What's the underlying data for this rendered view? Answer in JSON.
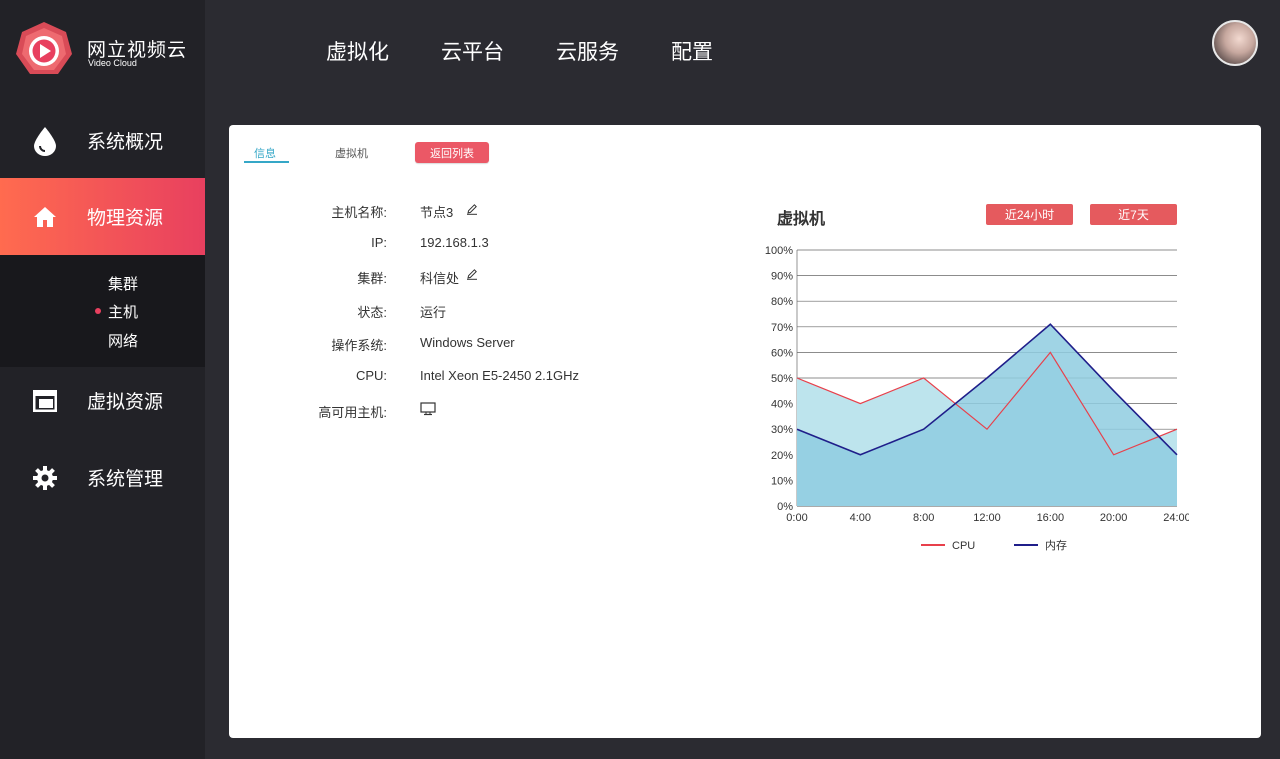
{
  "brand": {
    "title": "网立视频云",
    "subtitle": "Video Cloud"
  },
  "top_nav": [
    "虚拟化",
    "云平台",
    "云服务",
    "配置"
  ],
  "sidebar": {
    "items": [
      {
        "label": "系统概况",
        "icon": "drop-icon"
      },
      {
        "label": "物理资源",
        "icon": "home-icon",
        "active": true
      },
      {
        "label": "虚拟资源",
        "icon": "layout-icon"
      },
      {
        "label": "系统管理",
        "icon": "gear-icon"
      }
    ],
    "submenu": [
      {
        "label": "集群"
      },
      {
        "label": "主机",
        "active": true
      },
      {
        "label": "网络"
      }
    ]
  },
  "tabs": [
    {
      "label": "信息",
      "active": true
    },
    {
      "label": "虚拟机"
    }
  ],
  "back_button": "返回列表",
  "info": [
    {
      "label": "主机名称:",
      "value": "节点3",
      "editable": true
    },
    {
      "label": "IP:",
      "value": "192.168.1.3"
    },
    {
      "label": "集群:",
      "value": "科信处",
      "editable": true
    },
    {
      "label": "状态:",
      "value": "运行"
    },
    {
      "label": "操作系统:",
      "value": "Windows Server"
    },
    {
      "label": "CPU:",
      "value": "Intel Xeon E5-2450 2.1GHz"
    },
    {
      "label": "高可用主机:",
      "value": "",
      "icon": "monitor-icon"
    }
  ],
  "chart_title": "虚拟机",
  "range_buttons": [
    "近24小时",
    "近7天"
  ],
  "colors": {
    "accent": "#eb5866",
    "active_gradient_start": "#ff6b4f",
    "active_gradient_end": "#e8405f",
    "tab_blue": "#35a7c7"
  },
  "chart_data": {
    "type": "area",
    "title": "",
    "xlabel": "",
    "ylabel": "",
    "x": [
      "0:00",
      "4:00",
      "8:00",
      "12:00",
      "16:00",
      "20:00",
      "24:00"
    ],
    "y_ticks": [
      "0%",
      "10%",
      "20%",
      "30%",
      "40%",
      "50%",
      "60%",
      "70%",
      "80%",
      "90%",
      "100%"
    ],
    "ylim": [
      0,
      100
    ],
    "grid": true,
    "legend": "bottom",
    "series": [
      {
        "name": "CPU",
        "values": [
          50,
          40,
          50,
          30,
          60,
          20,
          30
        ],
        "color": "#e8404b",
        "fill": "#bde4ed"
      },
      {
        "name": "内存",
        "values": [
          30,
          20,
          30,
          50,
          71,
          45,
          20
        ],
        "color": "#1f1e8a",
        "fill": "#8fcde0"
      }
    ]
  }
}
